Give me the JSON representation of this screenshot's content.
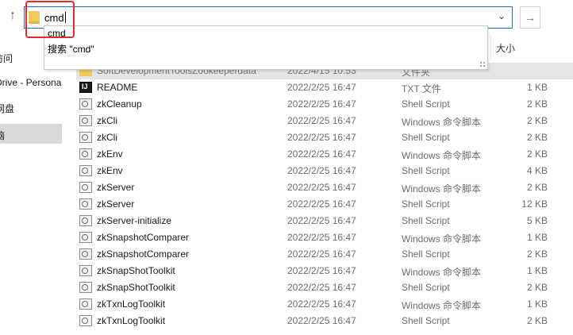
{
  "address_bar": {
    "value": "cmd"
  },
  "suggestions": [
    {
      "label": "cmd"
    },
    {
      "label": "搜索 \"cmd\""
    }
  ],
  "sidebar": {
    "items": [
      {
        "label": "访问"
      },
      {
        "label": "Drive - Personal"
      },
      {
        "label": "网盘"
      },
      {
        "label": "脑"
      }
    ]
  },
  "columns": {
    "size": "大小"
  },
  "files": [
    {
      "icon": "folder-icon",
      "name": "SoftDevelopmentToolsZookeeperdata",
      "date": "2022/4/15 10:53",
      "type": "文件夹",
      "size": ""
    },
    {
      "icon": "txt-file-icon",
      "name": "README",
      "date": "2022/2/25 16:47",
      "type": "TXT 文件",
      "size": "1 KB"
    },
    {
      "icon": "script-file-icon",
      "name": "zkCleanup",
      "date": "2022/2/25 16:47",
      "type": "Shell Script",
      "size": "2 KB"
    },
    {
      "icon": "script-file-icon",
      "name": "zkCli",
      "date": "2022/2/25 16:47",
      "type": "Windows 命令脚本",
      "size": "2 KB"
    },
    {
      "icon": "script-file-icon",
      "name": "zkCli",
      "date": "2022/2/25 16:47",
      "type": "Shell Script",
      "size": "2 KB"
    },
    {
      "icon": "script-file-icon",
      "name": "zkEnv",
      "date": "2022/2/25 16:47",
      "type": "Windows 命令脚本",
      "size": "2 KB"
    },
    {
      "icon": "script-file-icon",
      "name": "zkEnv",
      "date": "2022/2/25 16:47",
      "type": "Shell Script",
      "size": "4 KB"
    },
    {
      "icon": "script-file-icon",
      "name": "zkServer",
      "date": "2022/2/25 16:47",
      "type": "Windows 命令脚本",
      "size": "2 KB"
    },
    {
      "icon": "script-file-icon",
      "name": "zkServer",
      "date": "2022/2/25 16:47",
      "type": "Shell Script",
      "size": "12 KB"
    },
    {
      "icon": "script-file-icon",
      "name": "zkServer-initialize",
      "date": "2022/2/25 16:47",
      "type": "Shell Script",
      "size": "5 KB"
    },
    {
      "icon": "script-file-icon",
      "name": "zkSnapshotComparer",
      "date": "2022/2/25 16:47",
      "type": "Windows 命令脚本",
      "size": "1 KB"
    },
    {
      "icon": "script-file-icon",
      "name": "zkSnapshotComparer",
      "date": "2022/2/25 16:47",
      "type": "Shell Script",
      "size": "2 KB"
    },
    {
      "icon": "script-file-icon",
      "name": "zkSnapShotToolkit",
      "date": "2022/2/25 16:47",
      "type": "Windows 命令脚本",
      "size": "1 KB"
    },
    {
      "icon": "script-file-icon",
      "name": "zkSnapShotToolkit",
      "date": "2022/2/25 16:47",
      "type": "Shell Script",
      "size": "2 KB"
    },
    {
      "icon": "script-file-icon",
      "name": "zkTxnLogToolkit",
      "date": "2022/2/25 16:47",
      "type": "Windows 命令脚本",
      "size": "1 KB"
    },
    {
      "icon": "script-file-icon",
      "name": "zkTxnLogToolkit",
      "date": "2022/2/25 16:47",
      "type": "Shell Script",
      "size": "2 KB"
    }
  ]
}
